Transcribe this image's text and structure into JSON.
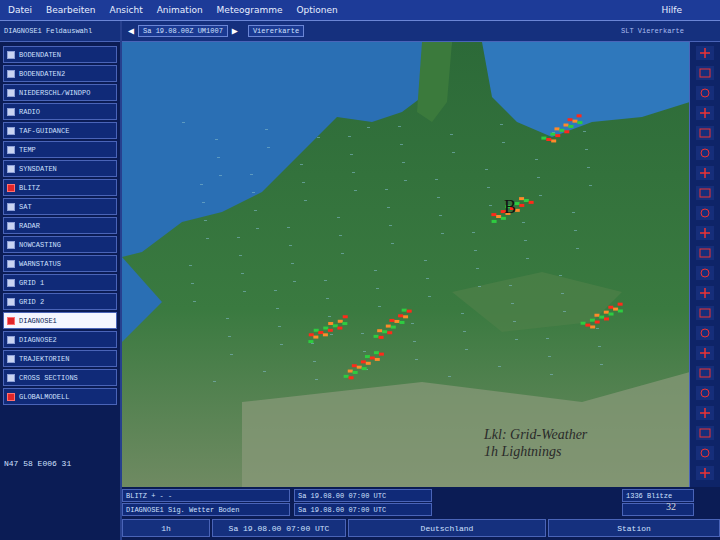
{
  "menu": [
    "Datei",
    "Bearbeiten",
    "Ansicht",
    "Animation",
    "Meteogramme",
    "Optionen"
  ],
  "menu_right": "Hilfe",
  "toolbar": {
    "field_select": "DIAGNOSE1 Feldauswahl",
    "prev": "◀",
    "time": "Sa 19.08.00Z UM1007",
    "next": "▶",
    "view": "Viererkarte",
    "right": "SLT Viererkarte"
  },
  "sidebar": {
    "items": [
      {
        "label": "BODENDATEN",
        "checked": false,
        "selected": false
      },
      {
        "label": "BODENDATEN2",
        "checked": false,
        "selected": false
      },
      {
        "label": "NIEDERSCHL/WINDPO",
        "checked": false,
        "selected": false
      },
      {
        "label": "RADIO",
        "checked": false,
        "selected": false
      },
      {
        "label": "TAF-GUIDANCE",
        "checked": false,
        "selected": false
      },
      {
        "label": "TEMP",
        "checked": false,
        "selected": false
      },
      {
        "label": "SYNSDATEN",
        "checked": false,
        "selected": false
      },
      {
        "label": "BLITZ",
        "checked": true,
        "selected": false
      },
      {
        "label": "SAT",
        "checked": false,
        "selected": false
      },
      {
        "label": "RADAR",
        "checked": false,
        "selected": false
      },
      {
        "label": "NOWCASTING",
        "checked": false,
        "selected": false
      },
      {
        "label": "WARNSTATUS",
        "checked": false,
        "selected": false
      },
      {
        "label": "GRID 1",
        "checked": false,
        "selected": false
      },
      {
        "label": "GRID 2",
        "checked": false,
        "selected": false
      },
      {
        "label": "DIAGNOSE1",
        "checked": true,
        "selected": true
      },
      {
        "label": "DIAGNOSE2",
        "checked": false,
        "selected": false
      },
      {
        "label": "TRAJEKTORIEN",
        "checked": false,
        "selected": false
      },
      {
        "label": "CROSS SECTIONS",
        "checked": false,
        "selected": false
      },
      {
        "label": "GLOBALMODELL",
        "checked": true,
        "selected": false
      }
    ],
    "coords": "N47 58 E006 31"
  },
  "map": {
    "marker": "B",
    "caption": [
      "Lkl: Grid-Weather",
      "1h Lightnings"
    ],
    "page": "32"
  },
  "status_rows": [
    [
      "BLITZ + - -",
      "Sa 19.08.00 07:00 UTC",
      "1336 Blitze"
    ],
    [
      "DIAGNOSE1 Sig. Wetter Boden",
      "Sa 19.08.00 07:00 UTC",
      ""
    ]
  ],
  "bottom_bar": {
    "step": "1h",
    "time": "Sa 19.08.00 07:00 UTC",
    "region": "Deutschland",
    "mode": "Station"
  }
}
